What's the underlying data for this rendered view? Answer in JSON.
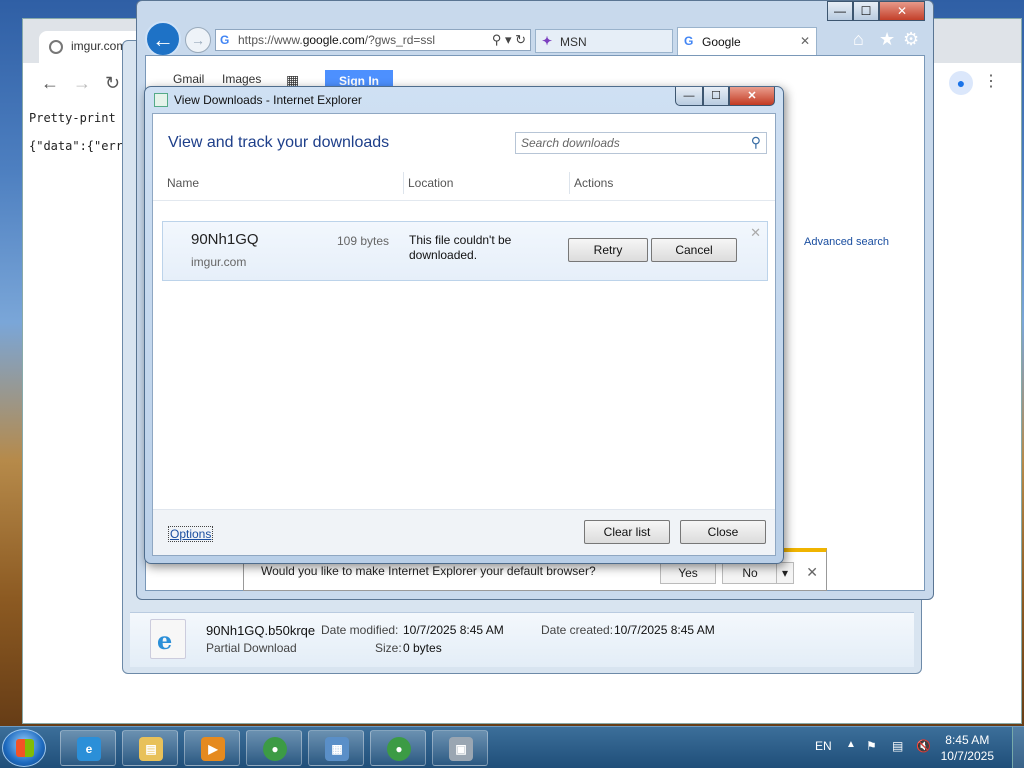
{
  "chrome": {
    "tab_title": "imgur.com/",
    "pretty_print": "Pretty-print",
    "json_body": "{\"data\":{\"err"
  },
  "explorer": {
    "file_name": "90Nh1GQ.b50krqe",
    "file_type": "Partial Download",
    "date_modified_label": "Date modified:",
    "date_modified": "10/7/2025 8:45 AM",
    "date_created_label": "Date created:",
    "date_created": "10/7/2025 8:45 AM",
    "size_label": "Size:",
    "size": "0 bytes"
  },
  "ie": {
    "address_prefix": "https://www.",
    "address_domain": "google.com",
    "address_suffix": "/?gws_rd=ssl",
    "tabs": [
      {
        "label": "MSN",
        "icon": "msn-icon"
      },
      {
        "label": "Google",
        "icon": "google-icon"
      }
    ],
    "page": {
      "gmail": "Gmail",
      "images": "Images",
      "sign_in": "Sign In",
      "advanced_search": "Advanced search"
    }
  },
  "default_bar": {
    "message": "Would you like to make Internet Explorer your default browser?",
    "yes": "Yes",
    "no": "No"
  },
  "downloads": {
    "window_title": "View Downloads - Internet Explorer",
    "heading": "View and track your downloads",
    "search_placeholder": "Search downloads",
    "columns": {
      "name": "Name",
      "location": "Location",
      "actions": "Actions"
    },
    "items": [
      {
        "name": "90Nh1GQ",
        "source": "imgur.com",
        "size": "109 bytes",
        "status": "This file couldn't be downloaded.",
        "retry": "Retry",
        "cancel": "Cancel"
      }
    ],
    "options": "Options",
    "clear_list": "Clear list",
    "close": "Close"
  },
  "taskbar": {
    "language": "EN",
    "time": "8:45 AM",
    "date": "10/7/2025"
  }
}
